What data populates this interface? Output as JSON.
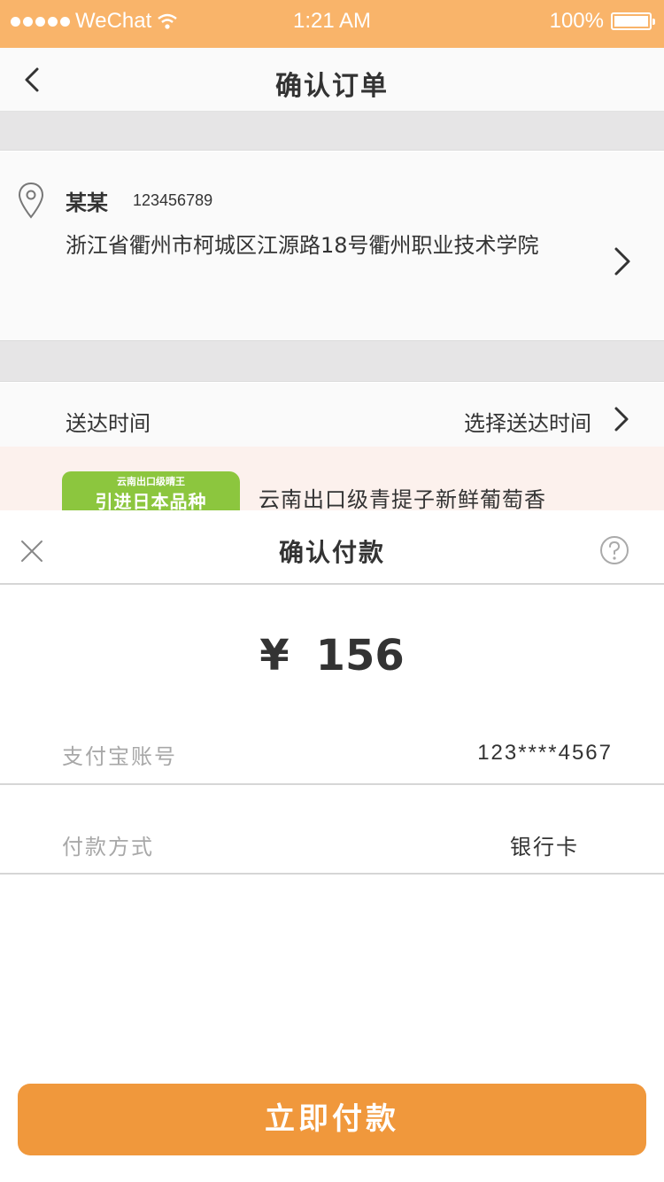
{
  "status_bar": {
    "carrier": "WeChat",
    "time": "1:21 AM",
    "battery": "100%",
    "battery_level": 1.0
  },
  "nav": {
    "title": "确认订单",
    "back_icon": "chevron-left-icon"
  },
  "address": {
    "name": "某某",
    "phone": "123456789",
    "line": "浙江省衢州市柯城区江源路18号衢州职业技术学院",
    "icon": "location-pin-icon"
  },
  "delivery": {
    "label": "送达时间",
    "value": "选择送达时间"
  },
  "product": {
    "image_small_text": "云南出口级晴王",
    "image_big_text": "引进日本品种",
    "name": "云南出口级青提子新鲜葡萄香"
  },
  "payment_sheet": {
    "title": "确认付款",
    "currency": "¥",
    "amount": "156",
    "account_label": "支付宝账号",
    "account_value": "123****4567",
    "method_label": "付款方式",
    "method_value": "银行卡",
    "pay_button": "立即付款"
  },
  "colors": {
    "status_bar": "#f9b46a",
    "pay_button": "#f0983c",
    "product_bg": "#fcf1ed",
    "separator_bg": "#e6e5e6"
  }
}
